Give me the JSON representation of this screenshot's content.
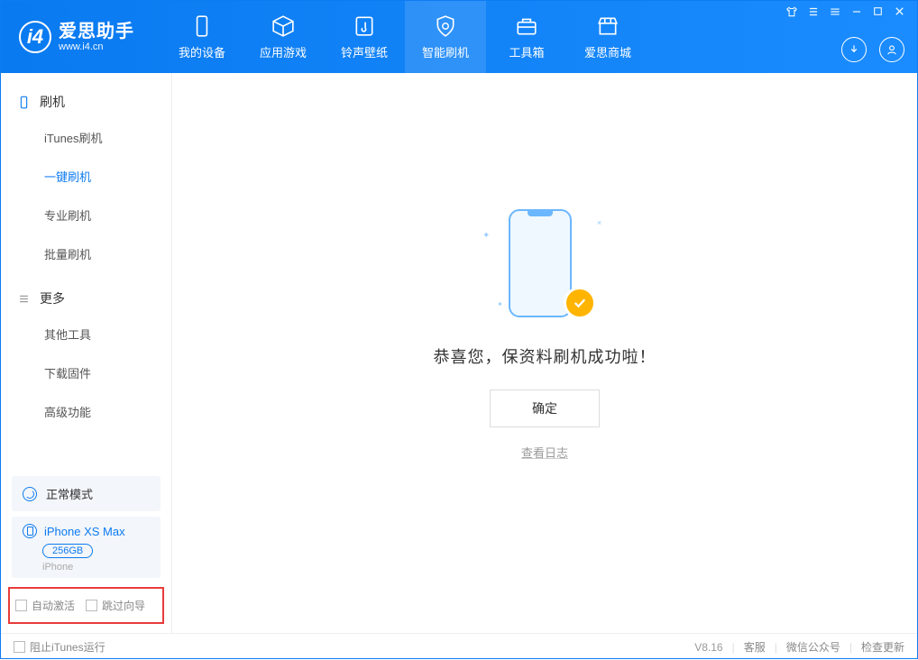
{
  "app": {
    "title": "爱思助手",
    "subtitle": "www.i4.cn"
  },
  "nav": {
    "tabs": [
      {
        "label": "我的设备"
      },
      {
        "label": "应用游戏"
      },
      {
        "label": "铃声壁纸"
      },
      {
        "label": "智能刷机"
      },
      {
        "label": "工具箱"
      },
      {
        "label": "爱思商城"
      }
    ]
  },
  "sidebar": {
    "section1_title": "刷机",
    "section1_items": [
      {
        "label": "iTunes刷机"
      },
      {
        "label": "一键刷机"
      },
      {
        "label": "专业刷机"
      },
      {
        "label": "批量刷机"
      }
    ],
    "section2_title": "更多",
    "section2_items": [
      {
        "label": "其他工具"
      },
      {
        "label": "下载固件"
      },
      {
        "label": "高级功能"
      }
    ]
  },
  "device_panel": {
    "mode_label": "正常模式",
    "device_name": "iPhone XS Max",
    "capacity": "256GB",
    "device_type": "iPhone"
  },
  "options": {
    "auto_activate": "自动激活",
    "skip_guide": "跳过向导"
  },
  "main": {
    "success_message": "恭喜您，保资料刷机成功啦！",
    "confirm_button": "确定",
    "view_log": "查看日志"
  },
  "statusbar": {
    "block_itunes": "阻止iTunes运行",
    "version": "V8.16",
    "support": "客服",
    "wechat": "微信公众号",
    "check_update": "检查更新"
  }
}
